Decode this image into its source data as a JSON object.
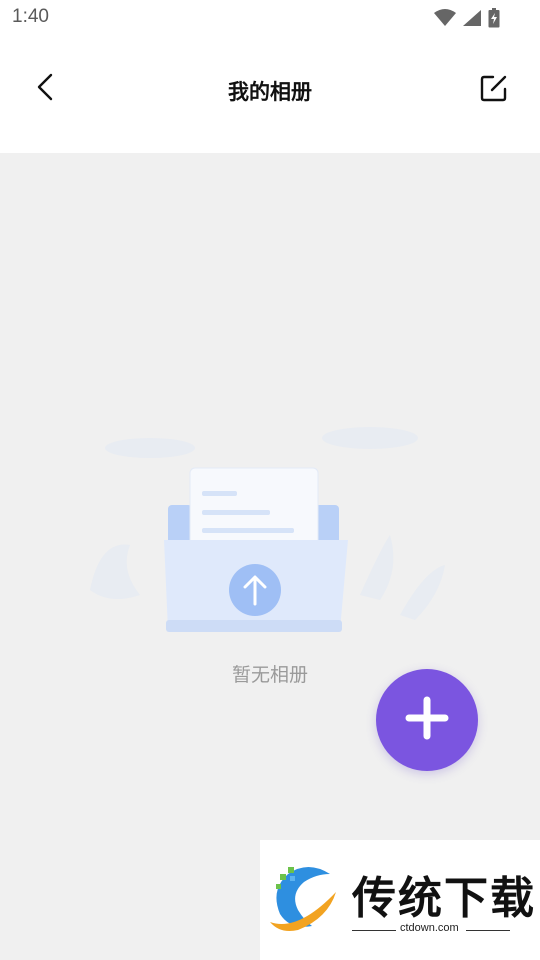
{
  "status_bar": {
    "time": "1:40",
    "icons": [
      "wifi-icon",
      "signal-icon",
      "battery-charging-icon"
    ]
  },
  "header": {
    "title": "我的相册",
    "back_icon": "chevron-left-icon",
    "edit_icon": "edit-icon"
  },
  "empty_state": {
    "text": "暂无相册",
    "illustration": "folder-upload-illustration"
  },
  "fab": {
    "icon": "plus-icon",
    "color": "#7b55e0"
  },
  "watermark": {
    "title": "传统下载",
    "domain": "ctdown.com"
  },
  "colors": {
    "accent": "#7b55e0",
    "background": "#f0f0f0",
    "illustration_blue": "#9fbff5"
  }
}
